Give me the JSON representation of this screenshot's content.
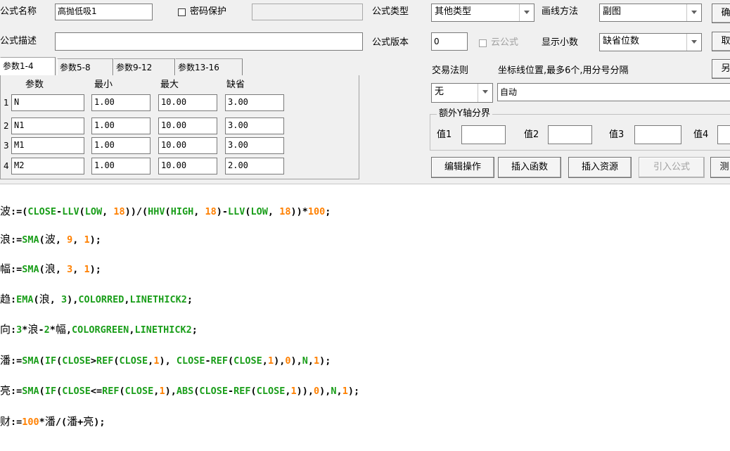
{
  "form": {
    "name_label": "公式名称",
    "name_value": "高抛低吸1",
    "password_label": "密码保护",
    "desc_label": "公式描述",
    "desc_value": "",
    "type_label": "公式类型",
    "type_value": "其他类型",
    "draw_label": "画线方法",
    "draw_value": "副图",
    "version_label": "公式版本",
    "version_value": "0",
    "cloud_label": "云公式",
    "decimals_label": "显示小数",
    "decimals_value": "缺省位数",
    "trade_rule_label": "交易法则",
    "trade_rule_value": "无",
    "axis_label": "坐标线位置,最多6个,用分号分隔",
    "axis_value": "自动",
    "extra_y_label": "额外Y轴分界",
    "v1_label": "值1",
    "v2_label": "值2",
    "v3_label": "值3",
    "v4_label": "值4"
  },
  "right_buttons": [
    "确",
    "取",
    "另"
  ],
  "tabs": [
    "参数1-4",
    "参数5-8",
    "参数9-12",
    "参数13-16"
  ],
  "params": {
    "headers": [
      "参数",
      "最小",
      "最大",
      "缺省"
    ],
    "rows": [
      {
        "num": "1",
        "name": "N",
        "min": "1.00",
        "max": "10.00",
        "def": "3.00"
      },
      {
        "num": "2",
        "name": "N1",
        "min": "1.00",
        "max": "10.00",
        "def": "3.00"
      },
      {
        "num": "3",
        "name": "M1",
        "min": "1.00",
        "max": "10.00",
        "def": "3.00"
      },
      {
        "num": "4",
        "name": "M2",
        "min": "1.00",
        "max": "10.00",
        "def": "2.00"
      }
    ]
  },
  "action_buttons": [
    "编辑操作",
    "插入函数",
    "插入资源",
    "引入公式",
    "测"
  ],
  "colors": {
    "function": "#1a9e1a",
    "number": "#ff8000",
    "text": "#000000"
  },
  "code_lines": [
    [
      [
        "波",
        "cn"
      ],
      [
        ":=(",
        "k"
      ],
      [
        "CLOSE",
        "g"
      ],
      [
        "-",
        "k"
      ],
      [
        "LLV",
        "g"
      ],
      [
        "(",
        "k"
      ],
      [
        "LOW",
        "g"
      ],
      [
        ", ",
        "k"
      ],
      [
        "18",
        "o"
      ],
      [
        "))/(",
        "k"
      ],
      [
        "HHV",
        "g"
      ],
      [
        "(",
        "k"
      ],
      [
        "HIGH",
        "g"
      ],
      [
        ", ",
        "k"
      ],
      [
        "18",
        "o"
      ],
      [
        ")-",
        "k"
      ],
      [
        "LLV",
        "g"
      ],
      [
        "(",
        "k"
      ],
      [
        "LOW",
        "g"
      ],
      [
        ", ",
        "k"
      ],
      [
        "18",
        "o"
      ],
      [
        "))*",
        "k"
      ],
      [
        "100",
        "o"
      ],
      [
        ";",
        "k"
      ]
    ],
    [
      [
        "浪",
        "cn"
      ],
      [
        ":=",
        "k"
      ],
      [
        "SMA",
        "g"
      ],
      [
        "(",
        "k"
      ],
      [
        "波",
        "cn"
      ],
      [
        ", ",
        "k"
      ],
      [
        "9",
        "o"
      ],
      [
        ", ",
        "k"
      ],
      [
        "1",
        "o"
      ],
      [
        ");",
        "k"
      ]
    ],
    [
      [
        "幅",
        "cn"
      ],
      [
        ":=",
        "k"
      ],
      [
        "SMA",
        "g"
      ],
      [
        "(",
        "k"
      ],
      [
        "浪",
        "cn"
      ],
      [
        ", ",
        "k"
      ],
      [
        "3",
        "o"
      ],
      [
        ", ",
        "k"
      ],
      [
        "1",
        "o"
      ],
      [
        ");",
        "k"
      ]
    ],
    [
      [
        "趋",
        "cn"
      ],
      [
        ":",
        "k"
      ],
      [
        "EMA",
        "g"
      ],
      [
        "(",
        "k"
      ],
      [
        "浪",
        "cn"
      ],
      [
        ", ",
        "k"
      ],
      [
        "3",
        "g"
      ],
      [
        "),",
        "k"
      ],
      [
        "COLORRED",
        "g"
      ],
      [
        ",",
        "k"
      ],
      [
        "LINETHICK2",
        "g"
      ],
      [
        ";",
        "k"
      ]
    ],
    [
      [
        "向",
        "cn"
      ],
      [
        ":",
        "k"
      ],
      [
        "3",
        "g"
      ],
      [
        "*",
        "k"
      ],
      [
        "浪",
        "cn"
      ],
      [
        "-",
        "k"
      ],
      [
        "2",
        "g"
      ],
      [
        "*",
        "k"
      ],
      [
        "幅",
        "cn"
      ],
      [
        ",",
        "k"
      ],
      [
        "COLORGREEN",
        "g"
      ],
      [
        ",",
        "k"
      ],
      [
        "LINETHICK2",
        "g"
      ],
      [
        ";",
        "k"
      ]
    ],
    [
      [
        "潘",
        "cn"
      ],
      [
        ":=",
        "k"
      ],
      [
        "SMA",
        "g"
      ],
      [
        "(",
        "k"
      ],
      [
        "IF",
        "g"
      ],
      [
        "(",
        "k"
      ],
      [
        "CLOSE",
        "g"
      ],
      [
        ">",
        "k"
      ],
      [
        "REF",
        "g"
      ],
      [
        "(",
        "k"
      ],
      [
        "CLOSE",
        "g"
      ],
      [
        ",",
        "k"
      ],
      [
        "1",
        "o"
      ],
      [
        "), ",
        "k"
      ],
      [
        "CLOSE",
        "g"
      ],
      [
        "-",
        "k"
      ],
      [
        "REF",
        "g"
      ],
      [
        "(",
        "k"
      ],
      [
        "CLOSE",
        "g"
      ],
      [
        ",",
        "k"
      ],
      [
        "1",
        "o"
      ],
      [
        "),",
        "k"
      ],
      [
        "0",
        "o"
      ],
      [
        "),",
        "k"
      ],
      [
        "N",
        "g"
      ],
      [
        ",",
        "k"
      ],
      [
        "1",
        "o"
      ],
      [
        ");",
        "k"
      ]
    ],
    [
      [
        "亮",
        "cn"
      ],
      [
        ":=",
        "k"
      ],
      [
        "SMA",
        "g"
      ],
      [
        "(",
        "k"
      ],
      [
        "IF",
        "g"
      ],
      [
        "(",
        "k"
      ],
      [
        "CLOSE",
        "g"
      ],
      [
        "<=",
        "k"
      ],
      [
        "REF",
        "g"
      ],
      [
        "(",
        "k"
      ],
      [
        "CLOSE",
        "g"
      ],
      [
        ",",
        "k"
      ],
      [
        "1",
        "o"
      ],
      [
        "),",
        "k"
      ],
      [
        "ABS",
        "g"
      ],
      [
        "(",
        "k"
      ],
      [
        "CLOSE",
        "g"
      ],
      [
        "-",
        "k"
      ],
      [
        "REF",
        "g"
      ],
      [
        "(",
        "k"
      ],
      [
        "CLOSE",
        "g"
      ],
      [
        ",",
        "k"
      ],
      [
        "1",
        "o"
      ],
      [
        ")),",
        "k"
      ],
      [
        "0",
        "o"
      ],
      [
        "),",
        "k"
      ],
      [
        "N",
        "g"
      ],
      [
        ",",
        "k"
      ],
      [
        "1",
        "o"
      ],
      [
        ");",
        "k"
      ]
    ],
    [
      [
        "财",
        "cn"
      ],
      [
        ":=",
        "k"
      ],
      [
        "100",
        "o"
      ],
      [
        "*",
        "k"
      ],
      [
        "潘",
        "cn"
      ],
      [
        "/(",
        "k"
      ],
      [
        "潘",
        "cn"
      ],
      [
        "+",
        "k"
      ],
      [
        "亮",
        "cn"
      ],
      [
        ");",
        "k"
      ]
    ]
  ]
}
